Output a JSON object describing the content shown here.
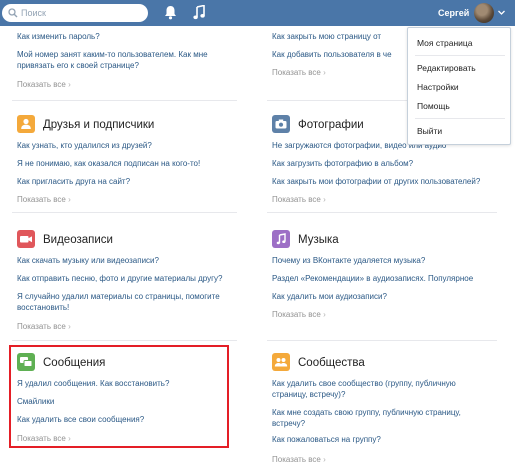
{
  "header": {
    "search_placeholder": "Поиск",
    "user_name": "Сергей",
    "accent": "#4a76a8"
  },
  "sections": {
    "top_left": {
      "questions": [
        "Как изменить пароль?",
        "Мой номер занят каким-то пользователем. Как мне привязать его к своей странице?"
      ],
      "show_all": "Показать все"
    },
    "top_right": {
      "questions": [
        "Как закрыть мою страницу от",
        "Как добавить пользователя в че"
      ],
      "show_all": "Показать все"
    },
    "friends": {
      "icon": "person-icon",
      "title": "Друзья и подписчики",
      "questions": [
        "Как узнать, кто удалился из друзей?",
        "Я не понимаю, как оказался подписан на кого-то!",
        "Как пригласить друга на сайт?"
      ],
      "show_all": "Показать все"
    },
    "photos": {
      "icon": "camera-icon",
      "title": "Фотографии",
      "questions": [
        "Не загружаются фотографии, видео или аудио",
        "Как загрузить фотографию в альбом?",
        "Как закрыть мои фотографии от других пользователей?"
      ],
      "show_all": "Показать все"
    },
    "videos": {
      "icon": "video-icon",
      "title": "Видеозаписи",
      "questions": [
        "Как скачать музыку или видеозаписи?",
        "Как отправить песню, фото и другие материалы другу?",
        "Я случайно удалил материалы со страницы, помогите восстановить!"
      ],
      "show_all": "Показать все"
    },
    "music": {
      "icon": "music-note-icon",
      "title": "Музыка",
      "questions": [
        "Почему из ВКонтакте удаляется музыка?",
        "Раздел «Рекомендации» в аудиозаписях. Популярное",
        "Как удалить мои аудиозаписи?"
      ],
      "show_all": "Показать все"
    },
    "messages": {
      "icon": "chat-bubbles-icon",
      "title": "Сообщения",
      "questions": [
        "Я удалил сообщения. Как восстановить?",
        "Смайлики",
        "Как удалить все свои сообщения?"
      ],
      "show_all": "Показать все"
    },
    "communities": {
      "icon": "people-icon",
      "title": "Сообщества",
      "questions": [
        "Как удалить свое сообщество (группу, публичную страницу, встречу)?",
        "Как мне создать свою группу, публичную страницу, встречу?",
        "Как пожаловаться на группу?"
      ],
      "show_all": "Показать все"
    }
  },
  "menu": {
    "items": [
      "Моя страница",
      "Редактировать",
      "Настройки",
      "Помощь",
      "Выйти"
    ]
  },
  "colors": {
    "friends_icon": "#f4a93b",
    "photos_icon": "#5e81a8",
    "videos_icon": "#e0575b",
    "music_icon": "#9d6fc6",
    "messages_icon": "#5fb053",
    "communities_icon": "#f4a93b",
    "highlight": "#e41e26"
  }
}
